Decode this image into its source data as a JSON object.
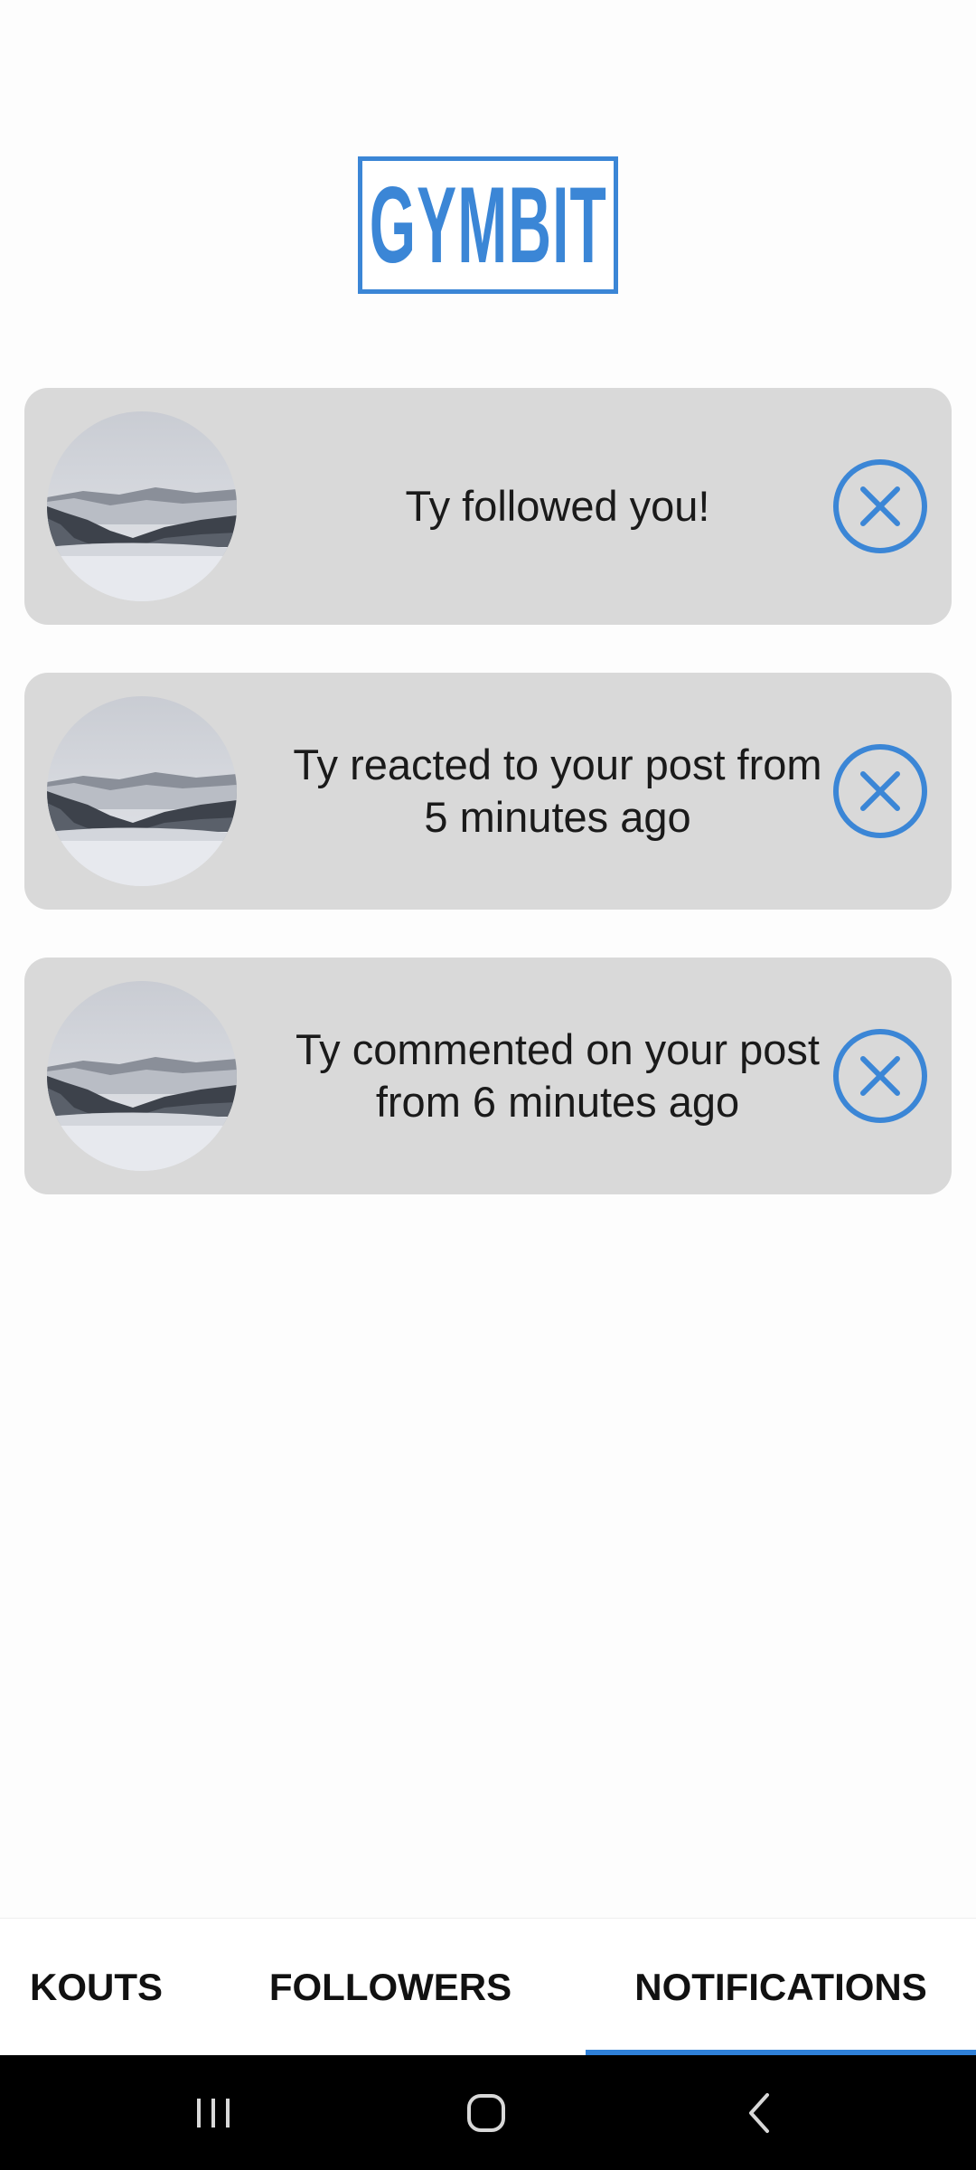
{
  "app": {
    "logo_text": "GYMBIT",
    "accent_color": "#3b86d6"
  },
  "notifications": [
    {
      "text": "Ty followed you!",
      "avatar_icon": "mountain-landscape-avatar",
      "dismiss_icon": "close-icon"
    },
    {
      "text": "Ty reacted to your post from 5 minutes ago",
      "avatar_icon": "mountain-landscape-avatar",
      "dismiss_icon": "close-icon"
    },
    {
      "text": "Ty commented on your post from 6 minutes ago",
      "avatar_icon": "mountain-landscape-avatar",
      "dismiss_icon": "close-icon"
    }
  ],
  "tabs": {
    "items": [
      {
        "label": "WORKOUTS",
        "visible_text": "KOUTS"
      },
      {
        "label": "FOLLOWERS",
        "visible_text": "FOLLOWERS"
      },
      {
        "label": "NOTIFICATIONS",
        "visible_text": "NOTIFICATIONS"
      }
    ],
    "selected": "NOTIFICATIONS",
    "indicator_color": "#2f80d8"
  },
  "system_nav": {
    "buttons": [
      "recent-apps-icon",
      "home-icon",
      "back-icon"
    ]
  }
}
